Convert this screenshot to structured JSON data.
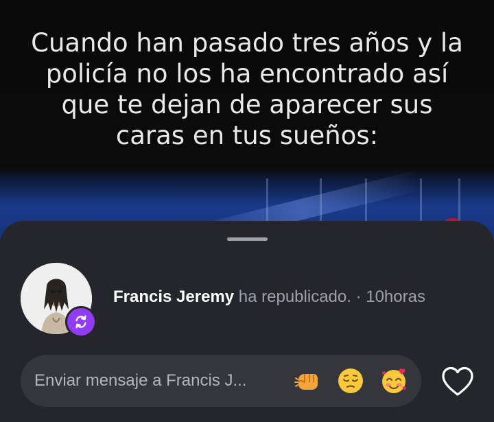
{
  "video": {
    "caption": "Cuando han pasado tres años y la\npolicía no los ha encontrado así\nque te dejan de aparecer sus\ncaras en tus sueños:"
  },
  "repost_sheet": {
    "username": "Francis Jeremy",
    "action_text": " ha republicado.",
    "separator": " · ",
    "time": "10horas"
  },
  "message_bar": {
    "placeholder": "Enviar mensaje a Francis J...",
    "quick_reactions": [
      "fist-bump-emoji",
      "pensive-face-emoji",
      "smiling-face-with-hearts-emoji"
    ]
  },
  "icons": {
    "repost": "repost-icon",
    "like": "heart-outline-icon"
  },
  "colors": {
    "sheet_background": "#24262b",
    "input_background": "#34363c",
    "repost_badge": "#8f3cf2"
  }
}
